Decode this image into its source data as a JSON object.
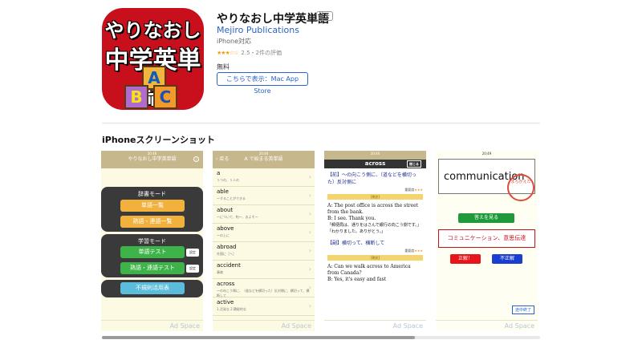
{
  "app": {
    "icon_line1": "やりなおし",
    "icon_line2": "中学英単語",
    "title": "やりなおし中学英単語",
    "age": "4+",
    "developer": "Mejiro Publications",
    "compat": "iPhone対応",
    "rating_value": "2.5・2件の評価",
    "price": "無料",
    "mac_button": "こちらで表示：Mac App Store"
  },
  "section_title": "iPhoneスクリーンショット",
  "ad_label": "Ad Space",
  "shot1": {
    "header": "やりなおし中学英単語",
    "dict_mode": "辞書モード",
    "btn_words": "単語一覧",
    "btn_idioms": "熟語・連語一覧",
    "study_mode": "学習モード",
    "btn_word_test": "単語テスト",
    "btn_idiom_test": "熟語・連語テスト",
    "settings": "設定",
    "btn_irregular": "不規則活用表"
  },
  "shot2": {
    "back": "戻る",
    "header": "A で始まる英単語",
    "words": [
      {
        "w": "a",
        "m": "１つの、１人の"
      },
      {
        "w": "able",
        "m": "～することができる"
      },
      {
        "w": "about",
        "m": "～について、約～、およそ～"
      },
      {
        "w": "above",
        "m": "～の上に"
      },
      {
        "w": "abroad",
        "m": "外国に［へ］"
      },
      {
        "w": "accident",
        "m": "事故"
      },
      {
        "w": "across",
        "m": "～の向こう側に、（道などを横切った）反対側に、横切って、横断して"
      },
      {
        "w": "active",
        "m": "1.活発な 2.積極的な"
      }
    ]
  },
  "shot3": {
    "header": "across",
    "close": "閉じる",
    "def1": "【前】～の向こう側に、（道などを横切った）反対側に",
    "importance": "重要度",
    "rei": "[例文]",
    "ex1a": "A: The post office is across the street from the bank.",
    "ex1b": "B: I see. Thank you.",
    "ex1c": "「郵便局は、通りをはさんで銀行の向こう側です。」",
    "ex1d": "「わかりました。ありがとう。」",
    "def2": "【副】横切って、横断して",
    "ex2a": "A: Can we walk across to America from Canada?",
    "ex2b": "B: Yes, it's easy and fast"
  },
  "shot4": {
    "time": "20:49",
    "word": "communication",
    "stamp": "まちがえた",
    "show_answer": "答えを見る",
    "answer": "コミュニケーション、意思伝達",
    "correct": "正解！",
    "wrong": "不正解",
    "quit": "途中終了"
  },
  "colors": {
    "icon_red": "#c8101c",
    "link_blue": "#2a62c8",
    "header_tan": "#c7b78c",
    "screen_cream": "#fdfae3"
  }
}
